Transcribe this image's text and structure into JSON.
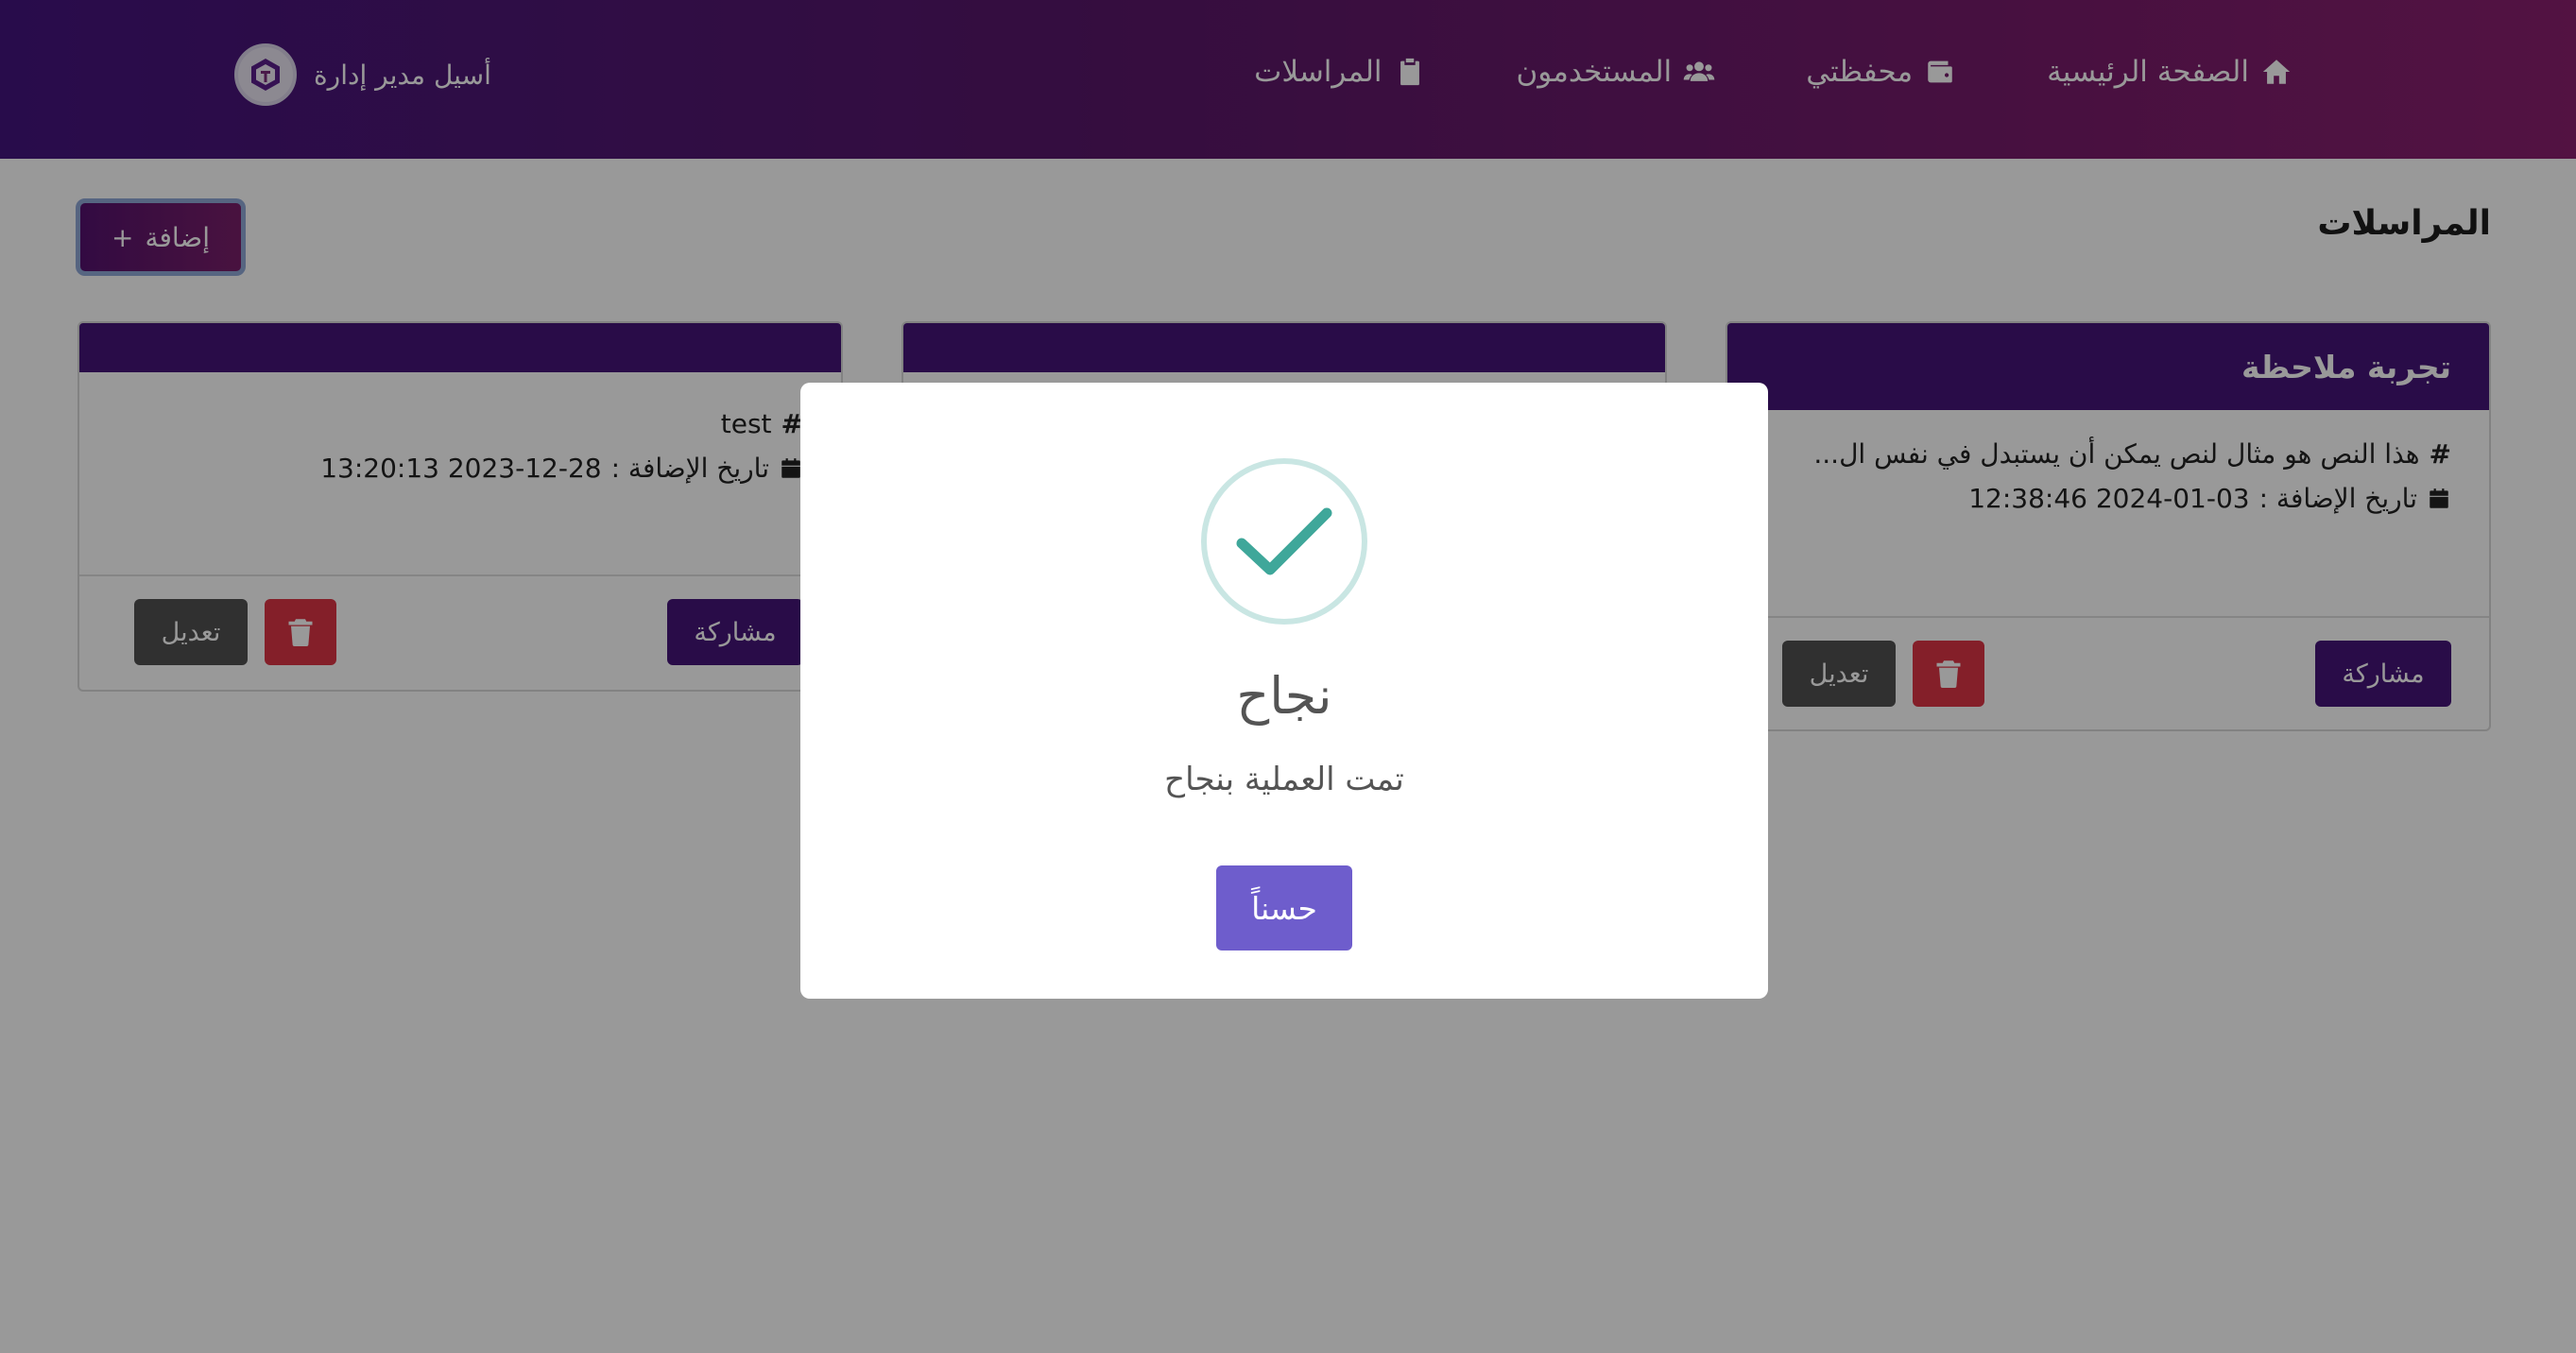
{
  "nav": {
    "items": [
      {
        "label": "الصفحة الرئيسية",
        "icon": "home-icon"
      },
      {
        "label": "محفظتي",
        "icon": "wallet-icon"
      },
      {
        "label": "المستخدمون",
        "icon": "users-icon"
      },
      {
        "label": "المراسلات",
        "icon": "clipboard-icon"
      }
    ],
    "profile_name": "أسيل مدير إدارة"
  },
  "page": {
    "title": "المراسلات",
    "add_label": "إضافة"
  },
  "cards": [
    {
      "title": "تجربة ملاحظة",
      "text": "هذا النص هو مثال لنص يمكن أن يستبدل في نفس ال...",
      "date_label": "تاريخ الإضافة :",
      "date": "2024-01-03 12:38:46",
      "share_label": "مشاركة",
      "edit_label": "تعديل"
    },
    {
      "title": "",
      "text": "",
      "date_label": "",
      "date": "",
      "share_label": "",
      "edit_label": ""
    },
    {
      "title": "",
      "text": "test",
      "date_label": "تاريخ الإضافة :",
      "date": "2023-12-28 13:20:13",
      "share_label": "مشاركة",
      "edit_label": "تعديل"
    }
  ],
  "modal": {
    "title": "نجاح",
    "message": "تمت العملية بنجاح",
    "ok_label": "حسناً"
  },
  "colors": {
    "primary": "#451479",
    "danger": "#dc3545",
    "confirm": "#6e5dcc",
    "success": "#3fa79a"
  }
}
